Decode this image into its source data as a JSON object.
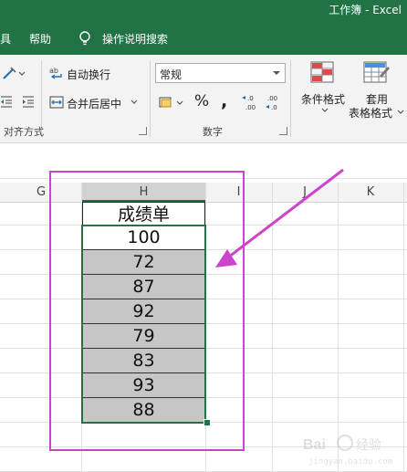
{
  "app": {
    "title": "工作簿 - Excel"
  },
  "menu": {
    "tab_partial": "具",
    "help": "帮助",
    "tell_me": "操作说明搜索"
  },
  "ribbon": {
    "alignment": {
      "wrap_text": "自动换行",
      "merge_center": "合并后居中",
      "group_label": "对齐方式"
    },
    "number": {
      "format_value": "常规",
      "group_label": "数字"
    },
    "styles": {
      "conditional_formatting": "条件格式",
      "format_as_table_line1": "套用",
      "format_as_table_line2": "表格格式"
    }
  },
  "grid": {
    "columns": [
      "G",
      "H",
      "I",
      "J",
      "K"
    ],
    "header_cell": "成绩单",
    "values": [
      "100",
      "72",
      "87",
      "92",
      "79",
      "83",
      "93",
      "88"
    ],
    "selection_color": "#217346",
    "shaded_fill": "#c6c6c6"
  },
  "annotation": {
    "color": "#cc44cc"
  },
  "watermark": {
    "text": "Bai 经验"
  }
}
